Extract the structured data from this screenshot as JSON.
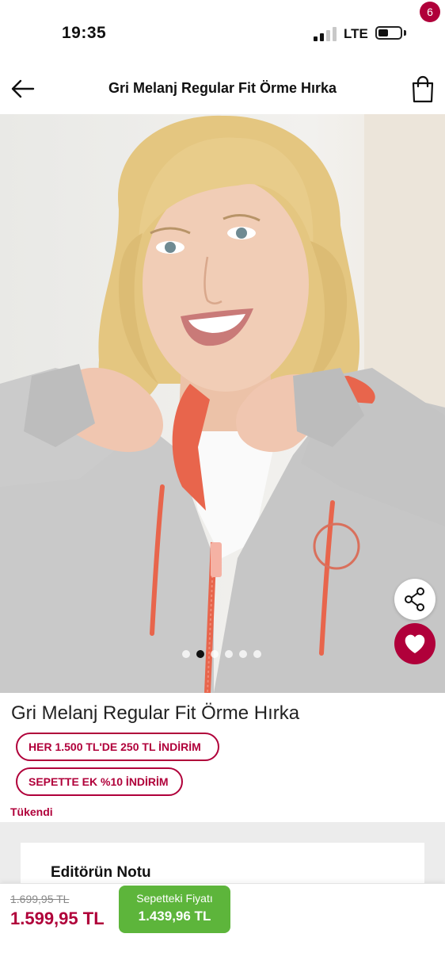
{
  "status_bar": {
    "time": "19:35",
    "network": "LTE",
    "battery_level": 0.3
  },
  "header": {
    "title": "Gri Melanj Regular Fit Örme Hırka",
    "back_icon": "arrow-left-icon",
    "cart_icon": "shopping-bag-icon",
    "cart_count": "6"
  },
  "gallery": {
    "image_count": 6,
    "active_index": 1,
    "share_icon": "share-icon",
    "favorite_icon": "heart-icon"
  },
  "product": {
    "name": "Gri Melanj Regular Fit Örme Hırka",
    "promotions": [
      "HER 1.500 TL'DE 250 TL İNDİRİM",
      "SEPETTE EK %10 İNDİRİM"
    ],
    "stock_status": "Tükendi"
  },
  "editor_note": {
    "title": "Editörün Notu"
  },
  "pricing": {
    "old_price": "1.699,95 TL",
    "price": "1.599,95 TL",
    "cart_price_label": "Sepetteki Fiyatı",
    "cart_price": "1.439,96 TL"
  },
  "colors": {
    "brand": "#b0003a",
    "cart_price_green": "#5db53b"
  }
}
